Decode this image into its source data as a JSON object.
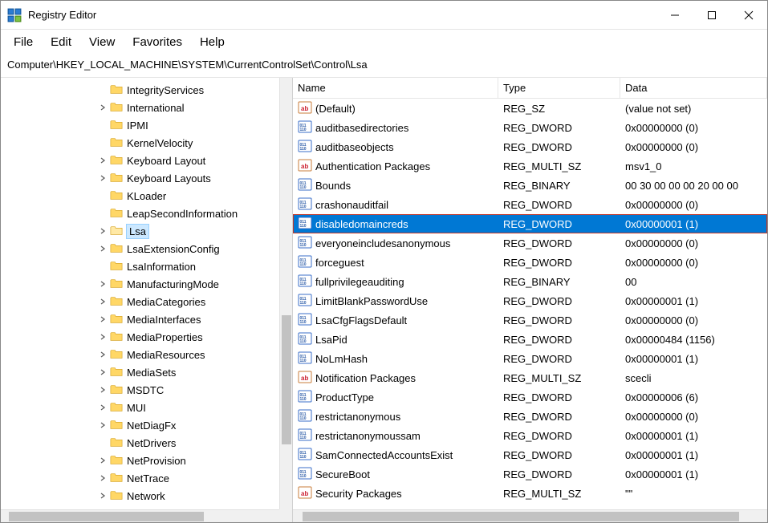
{
  "window": {
    "title": "Registry Editor"
  },
  "menubar": {
    "file": "File",
    "edit": "Edit",
    "view": "View",
    "favorites": "Favorites",
    "help": "Help"
  },
  "address": "Computer\\HKEY_LOCAL_MACHINE\\SYSTEM\\CurrentControlSet\\Control\\Lsa",
  "columns": {
    "name": "Name",
    "type": "Type",
    "data": "Data"
  },
  "tree": [
    {
      "label": "IntegrityServices",
      "expandable": false,
      "selected": false
    },
    {
      "label": "International",
      "expandable": true,
      "selected": false
    },
    {
      "label": "IPMI",
      "expandable": false,
      "selected": false
    },
    {
      "label": "KernelVelocity",
      "expandable": false,
      "selected": false
    },
    {
      "label": "Keyboard Layout",
      "expandable": true,
      "selected": false
    },
    {
      "label": "Keyboard Layouts",
      "expandable": true,
      "selected": false
    },
    {
      "label": "KLoader",
      "expandable": false,
      "selected": false
    },
    {
      "label": "LeapSecondInformation",
      "expandable": false,
      "selected": false
    },
    {
      "label": "Lsa",
      "expandable": true,
      "selected": true
    },
    {
      "label": "LsaExtensionConfig",
      "expandable": true,
      "selected": false
    },
    {
      "label": "LsaInformation",
      "expandable": false,
      "selected": false
    },
    {
      "label": "ManufacturingMode",
      "expandable": true,
      "selected": false
    },
    {
      "label": "MediaCategories",
      "expandable": true,
      "selected": false
    },
    {
      "label": "MediaInterfaces",
      "expandable": true,
      "selected": false
    },
    {
      "label": "MediaProperties",
      "expandable": true,
      "selected": false
    },
    {
      "label": "MediaResources",
      "expandable": true,
      "selected": false
    },
    {
      "label": "MediaSets",
      "expandable": true,
      "selected": false
    },
    {
      "label": "MSDTC",
      "expandable": true,
      "selected": false
    },
    {
      "label": "MUI",
      "expandable": true,
      "selected": false
    },
    {
      "label": "NetDiagFx",
      "expandable": true,
      "selected": false
    },
    {
      "label": "NetDrivers",
      "expandable": false,
      "selected": false
    },
    {
      "label": "NetProvision",
      "expandable": true,
      "selected": false
    },
    {
      "label": "NetTrace",
      "expandable": true,
      "selected": false
    },
    {
      "label": "Network",
      "expandable": true,
      "selected": false
    }
  ],
  "values": [
    {
      "icon": "string",
      "name": "(Default)",
      "type": "REG_SZ",
      "data": "(value not set)",
      "selected": false,
      "highlighted": false
    },
    {
      "icon": "binary",
      "name": "auditbasedirectories",
      "type": "REG_DWORD",
      "data": "0x00000000 (0)",
      "selected": false,
      "highlighted": false
    },
    {
      "icon": "binary",
      "name": "auditbaseobjects",
      "type": "REG_DWORD",
      "data": "0x00000000 (0)",
      "selected": false,
      "highlighted": false
    },
    {
      "icon": "string",
      "name": "Authentication Packages",
      "type": "REG_MULTI_SZ",
      "data": "msv1_0",
      "selected": false,
      "highlighted": false
    },
    {
      "icon": "binary",
      "name": "Bounds",
      "type": "REG_BINARY",
      "data": "00 30 00 00 00 20 00 00",
      "selected": false,
      "highlighted": false
    },
    {
      "icon": "binary",
      "name": "crashonauditfail",
      "type": "REG_DWORD",
      "data": "0x00000000 (0)",
      "selected": false,
      "highlighted": false
    },
    {
      "icon": "binary",
      "name": "disabledomaincreds",
      "type": "REG_DWORD",
      "data": "0x00000001 (1)",
      "selected": true,
      "highlighted": true
    },
    {
      "icon": "binary",
      "name": "everyoneincludesanonymous",
      "type": "REG_DWORD",
      "data": "0x00000000 (0)",
      "selected": false,
      "highlighted": false
    },
    {
      "icon": "binary",
      "name": "forceguest",
      "type": "REG_DWORD",
      "data": "0x00000000 (0)",
      "selected": false,
      "highlighted": false
    },
    {
      "icon": "binary",
      "name": "fullprivilegeauditing",
      "type": "REG_BINARY",
      "data": "00",
      "selected": false,
      "highlighted": false
    },
    {
      "icon": "binary",
      "name": "LimitBlankPasswordUse",
      "type": "REG_DWORD",
      "data": "0x00000001 (1)",
      "selected": false,
      "highlighted": false
    },
    {
      "icon": "binary",
      "name": "LsaCfgFlagsDefault",
      "type": "REG_DWORD",
      "data": "0x00000000 (0)",
      "selected": false,
      "highlighted": false
    },
    {
      "icon": "binary",
      "name": "LsaPid",
      "type": "REG_DWORD",
      "data": "0x00000484 (1156)",
      "selected": false,
      "highlighted": false
    },
    {
      "icon": "binary",
      "name": "NoLmHash",
      "type": "REG_DWORD",
      "data": "0x00000001 (1)",
      "selected": false,
      "highlighted": false
    },
    {
      "icon": "string",
      "name": "Notification Packages",
      "type": "REG_MULTI_SZ",
      "data": "scecli",
      "selected": false,
      "highlighted": false
    },
    {
      "icon": "binary",
      "name": "ProductType",
      "type": "REG_DWORD",
      "data": "0x00000006 (6)",
      "selected": false,
      "highlighted": false
    },
    {
      "icon": "binary",
      "name": "restrictanonymous",
      "type": "REG_DWORD",
      "data": "0x00000000 (0)",
      "selected": false,
      "highlighted": false
    },
    {
      "icon": "binary",
      "name": "restrictanonymoussam",
      "type": "REG_DWORD",
      "data": "0x00000001 (1)",
      "selected": false,
      "highlighted": false
    },
    {
      "icon": "binary",
      "name": "SamConnectedAccountsExist",
      "type": "REG_DWORD",
      "data": "0x00000001 (1)",
      "selected": false,
      "highlighted": false
    },
    {
      "icon": "binary",
      "name": "SecureBoot",
      "type": "REG_DWORD",
      "data": "0x00000001 (1)",
      "selected": false,
      "highlighted": false
    },
    {
      "icon": "string",
      "name": "Security Packages",
      "type": "REG_MULTI_SZ",
      "data": "\"\"",
      "selected": false,
      "highlighted": false
    }
  ]
}
